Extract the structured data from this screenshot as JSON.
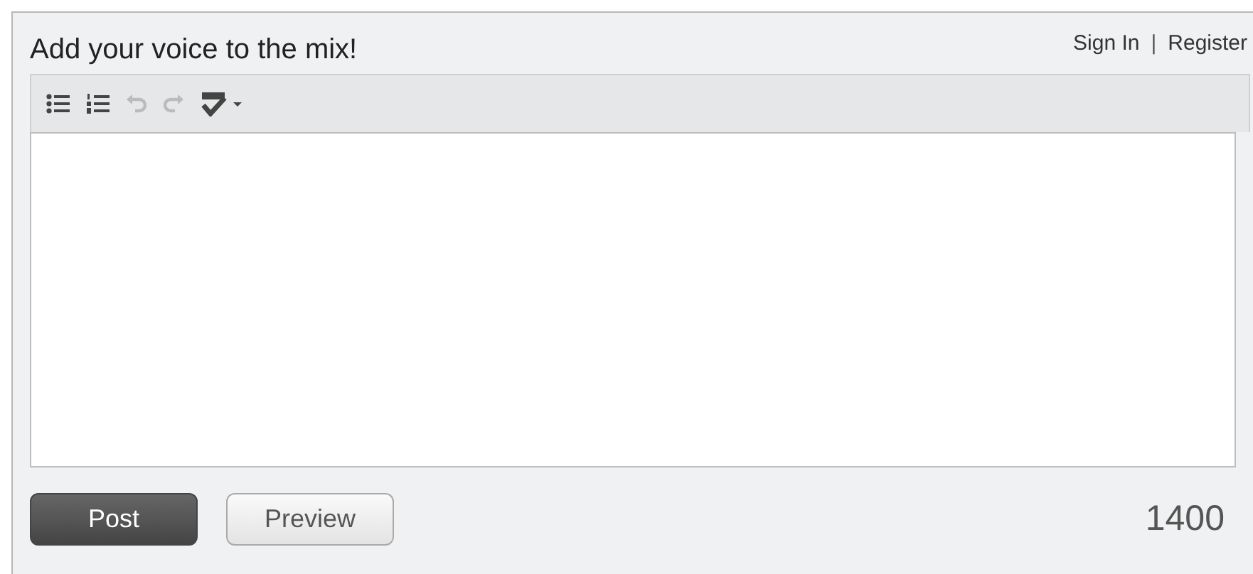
{
  "header": {
    "title": "Add your voice to the mix!",
    "links": [
      {
        "label": "Sign In"
      },
      {
        "label": "Register"
      }
    ],
    "separator": "|"
  },
  "toolbar": [
    {
      "kind": "bullets",
      "disabled": false
    },
    {
      "kind": "numbers",
      "disabled": false
    },
    {
      "kind": "undo",
      "disabled": true
    },
    {
      "kind": "redo",
      "disabled": true
    },
    {
      "kind": "spellcheck",
      "disabled": false
    }
  ],
  "buttons": [
    {
      "label": "Post",
      "kind": "primary"
    },
    {
      "label": "Preview",
      "kind": "secondary"
    }
  ],
  "counter": "1400"
}
